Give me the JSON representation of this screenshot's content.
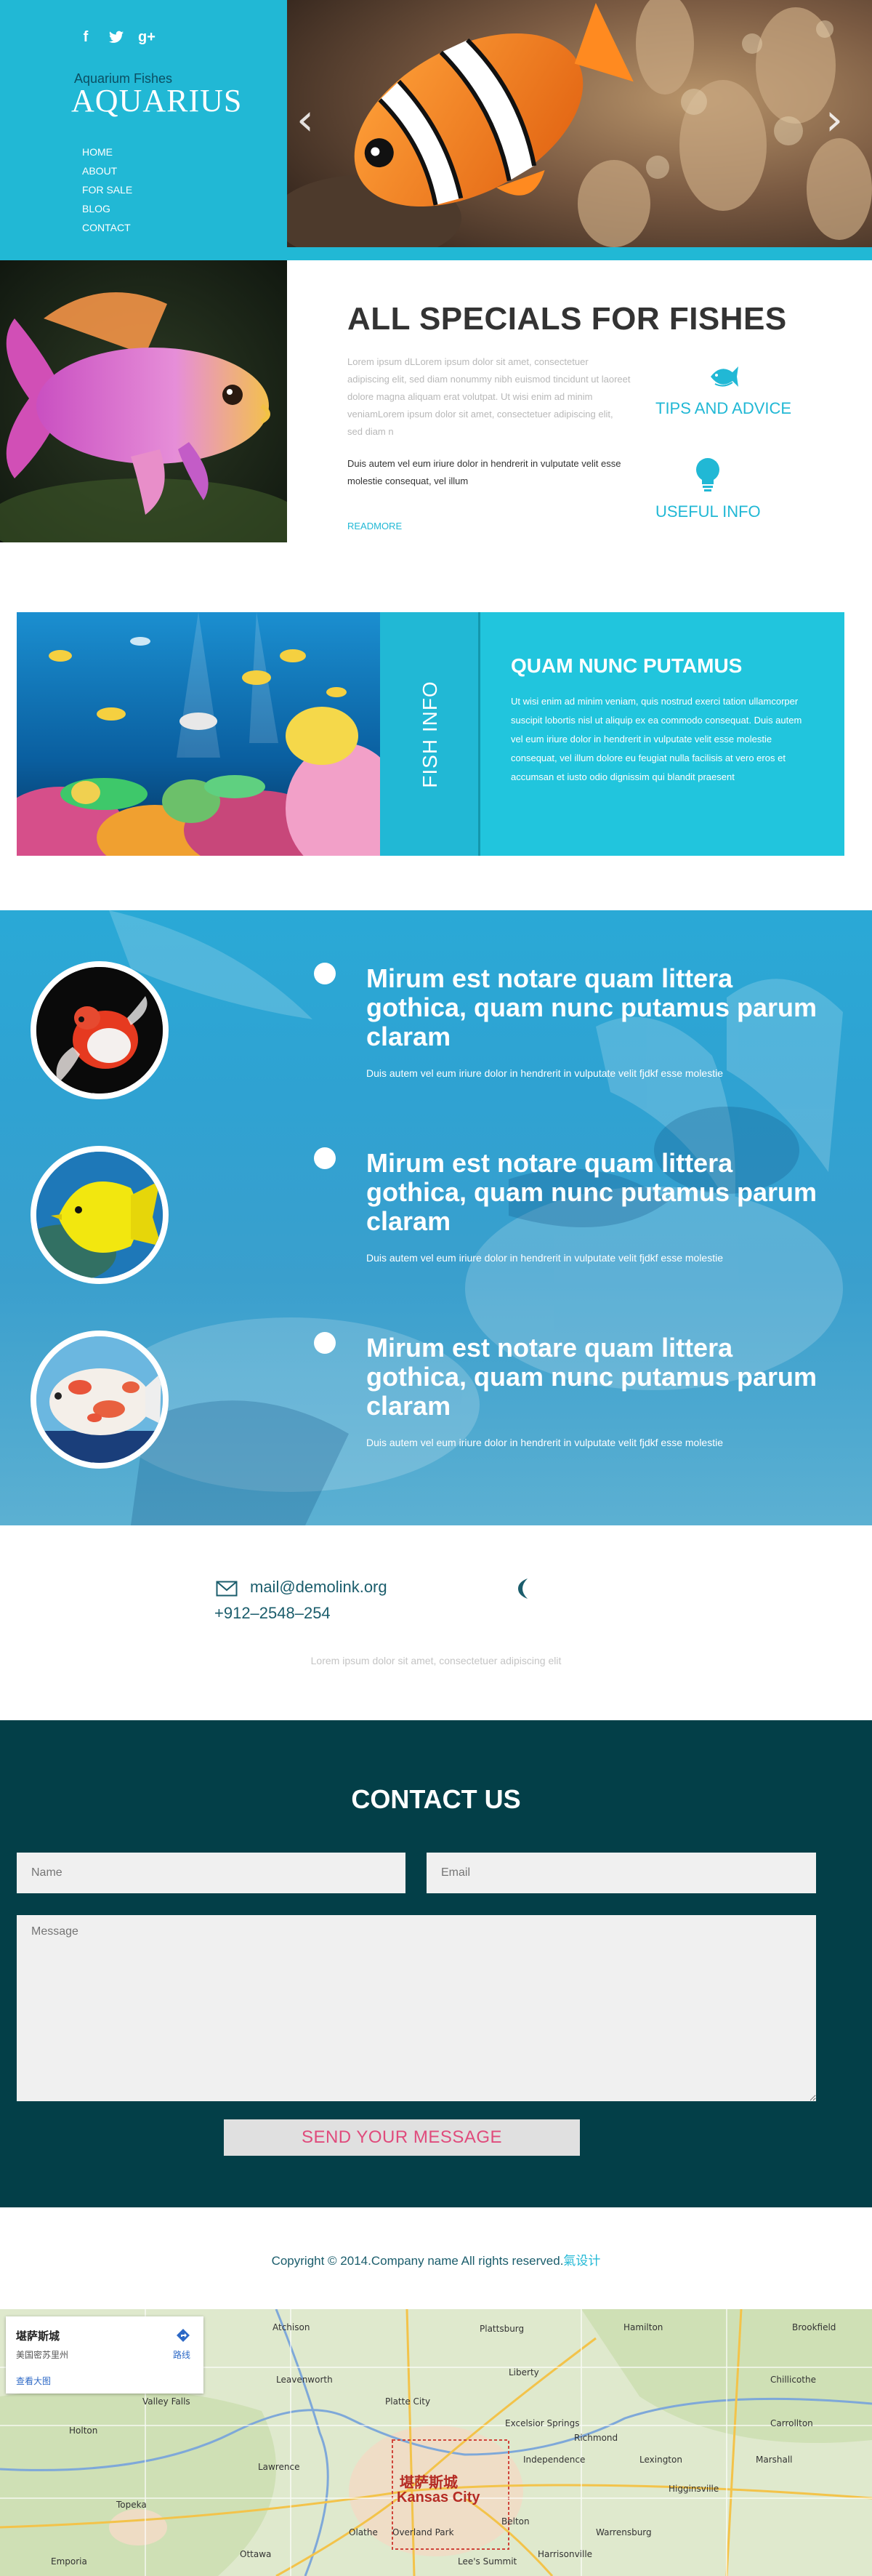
{
  "colors": {
    "accent": "#21b8d5",
    "dark_teal": "#033f48",
    "send_text": "#e04b7c"
  },
  "header": {
    "social": [
      {
        "icon": "facebook-icon",
        "glyph": "f"
      },
      {
        "icon": "twitter-icon",
        "glyph": "🐦"
      },
      {
        "icon": "google-plus-icon",
        "glyph": "g+"
      }
    ],
    "tagline": "Aquarium Fishes",
    "logo": "AQUARIUS",
    "nav": [
      "HOME",
      "ABOUT",
      "FOR SALE",
      "BLOG",
      "CONTACT"
    ],
    "slider": {
      "prev": "‹",
      "next": "›"
    }
  },
  "specials": {
    "title": "ALL SPECIALS FOR FISHES",
    "lorem": "Lorem ipsum dLLorem ipsum dolor sit amet, consectetuer adipiscing elit, sed diam nonummy nibh euismod tincidunt ut laoreet dolore magna aliquam erat volutpat. Ut wisi enim ad minim veniamLorem ipsum dolor sit amet, consectetuer adipiscing elit, sed diam n",
    "duis": "Duis autem vel eum iriure dolor in hendrerit in vulputate velit esse molestie consequat, vel illum",
    "readmore": "READMORE",
    "features": [
      {
        "icon": "fish-icon",
        "label": "TIPS AND ADVICE"
      },
      {
        "icon": "lightbulb-icon",
        "label": "USEFUL INFO"
      }
    ]
  },
  "fishinfo": {
    "tab": "FISH INFO",
    "title": "QUAM NUNC PUTAMUS",
    "text": "Ut wisi enim ad minim veniam, quis nostrud exerci tation ullamcorper suscipit lobortis nisl ut aliquip ex ea commodo consequat. Duis autem vel eum iriure dolor in hendrerit in vulputate velit esse molestie consequat, vel illum dolore eu feugiat nulla facilisis at vero eros et accumsan et iusto odio dignissim qui blandit praesent"
  },
  "timeline": [
    {
      "title": "Mirum est notare quam littera gothica, quam nunc putamus parum claram",
      "text": "Duis autem vel eum iriure dolor in hendrerit in vulputate velit fjdkf esse molestie"
    },
    {
      "title": "Mirum est notare quam littera gothica, quam nunc putamus parum claram",
      "text": "Duis autem vel eum iriure dolor in hendrerit in vulputate velit fjdkf esse molestie"
    },
    {
      "title": "Mirum est notare quam littera gothica, quam nunc putamus parum claram",
      "text": "Duis autem vel eum iriure dolor in hendrerit in vulputate velit fjdkf esse molestie"
    }
  ],
  "contact_info": {
    "email": "mail@demolink.org",
    "phone": "+912–2548–254",
    "lorem": "Lorem ipsum dolor sit amet, consectetuer adipiscing elit"
  },
  "contact_form": {
    "title": "CONTACT US",
    "name_placeholder": "Name",
    "email_placeholder": "Email",
    "message_placeholder": "Message",
    "send_label": "SEND YOUR MESSAGE"
  },
  "footer": {
    "copyright": "Copyright © 2014.Company name All rights reserved.",
    "link": "氣设计"
  },
  "map": {
    "city": "堪萨斯城",
    "state": "美国密苏里州",
    "larger": "查看大图",
    "directions": "路线",
    "city_cn_label": "堪萨斯城",
    "city_en_label": "Kansas City",
    "places": [
      {
        "text": "Atchison"
      },
      {
        "text": "Platte City"
      },
      {
        "text": "Liberty"
      },
      {
        "text": "Lawrence"
      },
      {
        "text": "Olathe"
      },
      {
        "text": "Lee's Summit"
      },
      {
        "text": "Independence"
      },
      {
        "text": "Overland Park"
      },
      {
        "text": "Topeka"
      },
      {
        "text": "Excelsior Springs"
      },
      {
        "text": "Richmond"
      },
      {
        "text": "Lexington"
      },
      {
        "text": "Warrensburg"
      },
      {
        "text": "Harrisonville"
      },
      {
        "text": "Belton"
      },
      {
        "text": "Ottawa"
      },
      {
        "text": "Holton"
      },
      {
        "text": "Emporia"
      },
      {
        "text": "Leavenworth"
      },
      {
        "text": "Valley Falls"
      },
      {
        "text": "Marshall"
      },
      {
        "text": "Chillicothe"
      },
      {
        "text": "Carrollton"
      },
      {
        "text": "Higginsville"
      },
      {
        "text": "Plattsburg"
      },
      {
        "text": "Hamilton"
      },
      {
        "text": "Brookfield"
      }
    ]
  }
}
